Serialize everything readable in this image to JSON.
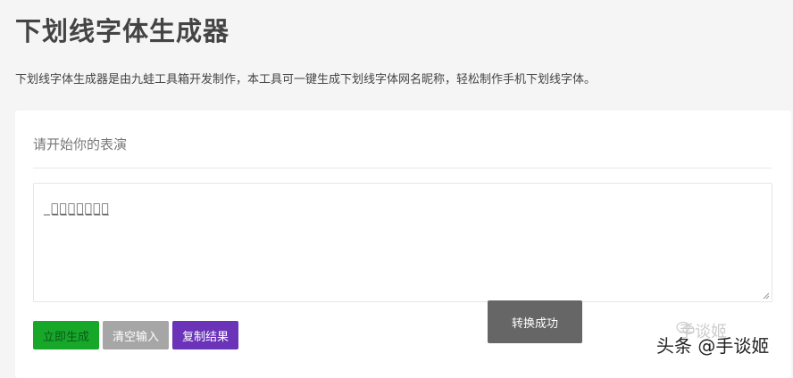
{
  "page": {
    "title": "下划线字体生成器",
    "description": "下划线字体生成器是由九蛙工具箱开发制作，本工具可一键生成下划线字体网名昵称，轻松制作手机下划线字体。"
  },
  "card": {
    "header": "请开始你的表演",
    "textarea_value": "̲手̲谈̲姬̲天̲下̲第̲一̲"
  },
  "buttons": {
    "generate": "立即生成",
    "clear": "清空输入",
    "copy": "复制结果"
  },
  "toast": {
    "message": "转换成功"
  },
  "watermark": {
    "text": "头条 @手谈姬",
    "faint_text": "手谈姬"
  },
  "colors": {
    "generate": "#17a82a",
    "clear": "#a6a6a6",
    "copy": "#6a33b8",
    "toast": "#666666"
  }
}
